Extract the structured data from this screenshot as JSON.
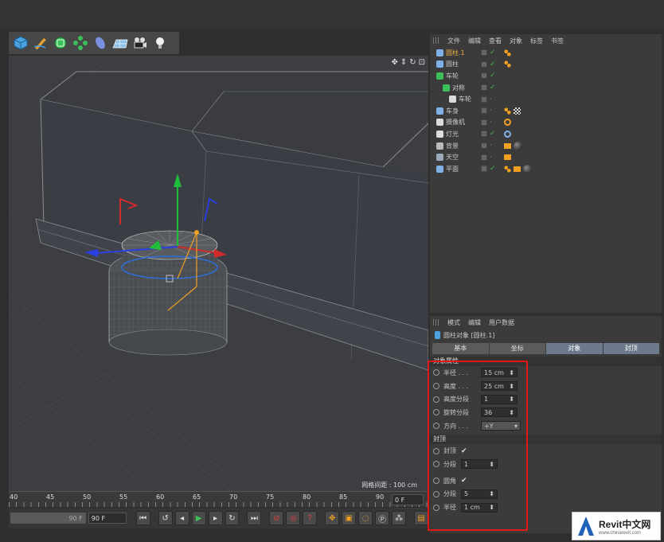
{
  "toolbar": {
    "icons": [
      "cube-icon",
      "pen-icon",
      "subdivide-icon",
      "array-icon",
      "deformer-icon",
      "floor-icon",
      "camera-icon",
      "light-icon"
    ]
  },
  "viewport": {
    "nav_icons": [
      "✥",
      "⇕",
      "↻",
      "⊡"
    ],
    "grid_info": "网格间距 : 100 cm"
  },
  "timeline": {
    "ticks": [
      "40",
      "45",
      "50",
      "55",
      "60",
      "65",
      "70",
      "75",
      "80",
      "85",
      "90"
    ],
    "current_frame": "0 F"
  },
  "controls": {
    "end_frame": "90 F",
    "max_frame": "90 F"
  },
  "object_manager": {
    "menu": [
      "文件",
      "编辑",
      "查看",
      "对象",
      "标签",
      "书签"
    ],
    "objects": [
      {
        "name": "圆柱.1",
        "indent": 0,
        "color": "#f0b040",
        "tags": [
          "dots"
        ],
        "check": true,
        "icon": "cylinder-icon"
      },
      {
        "name": "圆柱",
        "indent": 0,
        "color": "#c8c8c8",
        "tags": [
          "dots"
        ],
        "check": true,
        "icon": "cylinder-icon"
      },
      {
        "name": "车轮",
        "indent": 0,
        "color": "#c8c8c8",
        "tags": [],
        "check": true,
        "icon": "symmetry-icon"
      },
      {
        "name": "对称",
        "indent": 1,
        "color": "#c8c8c8",
        "tags": [],
        "check": true,
        "icon": "symmetry-icon"
      },
      {
        "name": "车轮",
        "indent": 2,
        "color": "#c8c8c8",
        "tags": [],
        "check": false,
        "icon": "lo-icon"
      },
      {
        "name": "车身",
        "indent": 0,
        "color": "#c8c8c8",
        "tags": [
          "dots",
          "checker"
        ],
        "check": false,
        "icon": "body-icon"
      },
      {
        "name": "摄像机",
        "indent": 0,
        "color": "#c8c8c8",
        "tags": [
          "target"
        ],
        "check": false,
        "icon": "camera-icon"
      },
      {
        "name": "灯光",
        "indent": 0,
        "color": "#c8c8c8",
        "tags": [
          "ring"
        ],
        "check": true,
        "icon": "light-icon"
      },
      {
        "name": "背景",
        "indent": 0,
        "color": "#c8c8c8",
        "tags": [
          "film",
          "sphere"
        ],
        "check": false,
        "icon": "background-icon"
      },
      {
        "name": "天空",
        "indent": 0,
        "color": "#c8c8c8",
        "tags": [
          "film"
        ],
        "check": false,
        "icon": "sky-icon"
      },
      {
        "name": "平面",
        "indent": 0,
        "color": "#c8c8c8",
        "tags": [
          "dots",
          "film",
          "sphere"
        ],
        "check": true,
        "icon": "plane-icon"
      }
    ]
  },
  "attribute_manager": {
    "menu": [
      "模式",
      "编辑",
      "用户数据"
    ],
    "title": "圆柱对象 [圆柱.1]",
    "tabs": [
      "基本",
      "坐标",
      "对象",
      "封顶"
    ],
    "active_tab": 2,
    "section_object": "对象属性",
    "props": [
      {
        "label": "半径 . . .",
        "value": "15 cm"
      },
      {
        "label": "高度 . . .",
        "value": "25 cm"
      },
      {
        "label": "高度分段",
        "value": "1"
      },
      {
        "label": "旋转分段",
        "value": "36"
      }
    ],
    "orientation": {
      "label": "方向 . . .",
      "value": "+Y"
    },
    "section_caps": "封顶",
    "caps": {
      "label": "封顶",
      "checked": "✔"
    },
    "caps_seg": {
      "label": "分段",
      "value": "1"
    },
    "fillet": {
      "label": "圆角",
      "checked": "✔"
    },
    "fillet_seg": {
      "label": "分段",
      "value": "5"
    },
    "fillet_radius": {
      "label": "半径",
      "value": "1 cm"
    }
  },
  "watermark": {
    "brand": "Revit中文网",
    "url": "www.chinarevit.com"
  }
}
